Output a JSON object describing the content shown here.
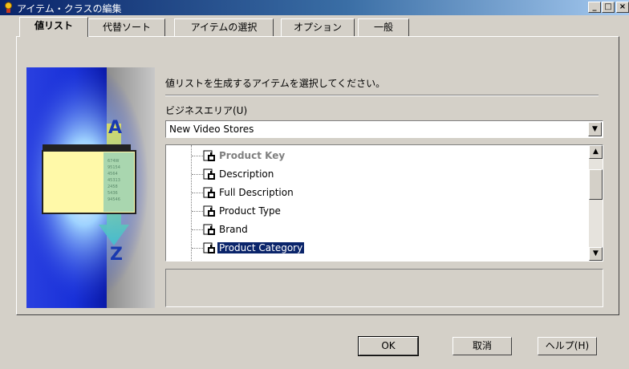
{
  "window": {
    "title": "アイテム・クラスの編集",
    "controls": [
      "_",
      "□",
      "×"
    ]
  },
  "tabs": [
    {
      "label": "値リスト",
      "active": true
    },
    {
      "label": "代替ソート",
      "active": false
    },
    {
      "label": "アイテムの選択",
      "active": false
    },
    {
      "label": "オプション",
      "active": false
    },
    {
      "label": "一般",
      "active": false
    }
  ],
  "illustration": {
    "letter_top": "A",
    "letter_bottom": "Z",
    "icon": "sort-illustration-icon"
  },
  "main": {
    "instruction": "値リストを生成するアイテムを選択してください。",
    "business_area_label": "ビジネスエリア(U)",
    "business_area_value": "New Video Stores"
  },
  "tree": {
    "items": [
      {
        "label": "Product Key",
        "state": "disabled"
      },
      {
        "label": "Description",
        "state": "normal"
      },
      {
        "label": "Full Description",
        "state": "normal"
      },
      {
        "label": "Product Type",
        "state": "normal"
      },
      {
        "label": "Brand",
        "state": "normal"
      },
      {
        "label": "Product Category",
        "state": "selected"
      }
    ],
    "item_icon": "item-folder-icon"
  },
  "buttons": {
    "ok": "OK",
    "cancel": "取消",
    "help": "ヘルプ(H)"
  },
  "colors": {
    "title_start": "#0a246a",
    "title_end": "#a6caf0",
    "selection": "#0a246a",
    "face": "#d4d0c8"
  }
}
